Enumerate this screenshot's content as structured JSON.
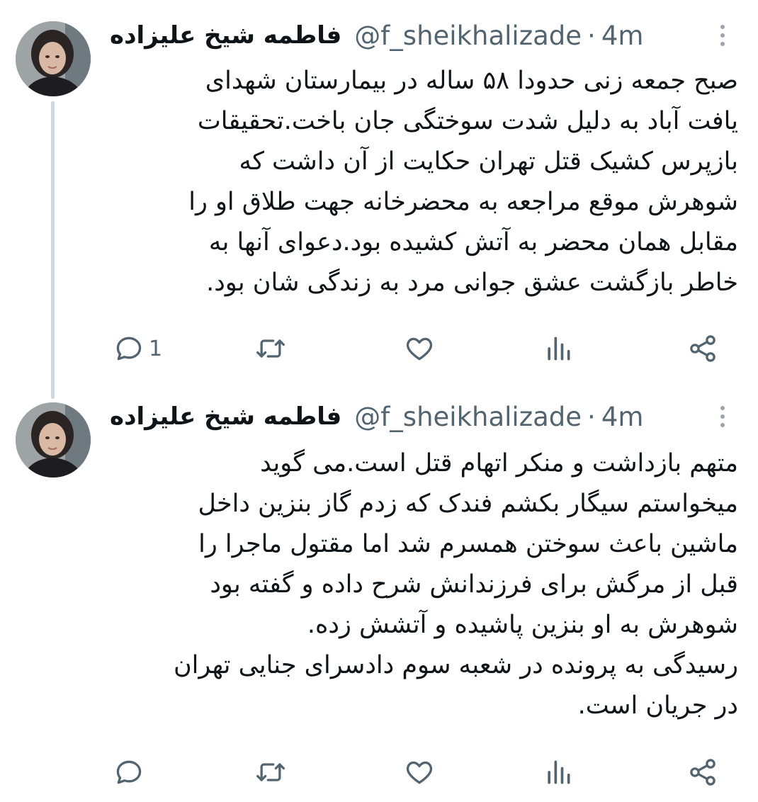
{
  "tweets": [
    {
      "author_name": "فاطمه شیخ علیزاده",
      "handle": "@f_sheikhalizade",
      "separator": "·",
      "time": "4m",
      "lines": [
        "صبح جمعه زنی حدودا ۵۸ ساله در بیمارستان شهدای",
        "یافت آباد به دلیل شدت سوختگی جان باخت.تحقیقات",
        "بازپرس کشیک قتل تهران حکایت از آن داشت که",
        "شوهرش موقع مراجعه به محضرخانه جهت طلاق او را",
        "مقابل همان محضر به آتش کشیده بود.دعوای آنها به",
        "خاطر بازگشت عشق جوانی مرد به زندگی شان بود."
      ],
      "reply_count": "1",
      "icons": [
        "reply-icon",
        "retweet-icon",
        "like-icon",
        "views-icon",
        "share-icon"
      ]
    },
    {
      "author_name": "فاطمه شیخ علیزاده",
      "handle": "@f_sheikhalizade",
      "separator": "·",
      "time": "4m",
      "lines": [
        "متهم بازداشت و منکر اتهام قتل است.می گوید",
        "میخواستم سیگار بکشم فندک که زدم گاز بنزین داخل",
        "ماشین باعث سوختن همسرم شد اما مقتول ماجرا را",
        "قبل از مرگش برای فرزندانش شرح داده و گفته بود",
        "شوهرش به او بنزین پاشیده و آتشش زده.",
        "رسیدگی به پرونده در شعبه سوم دادسرای جنایی تهران",
        "در جریان است."
      ],
      "reply_count": "",
      "icons": [
        "reply-icon",
        "retweet-icon",
        "like-icon",
        "views-icon",
        "share-icon"
      ]
    }
  ],
  "colors": {
    "text": "#0f1419",
    "muted": "#536471",
    "thread_line": "#cfd9de"
  }
}
